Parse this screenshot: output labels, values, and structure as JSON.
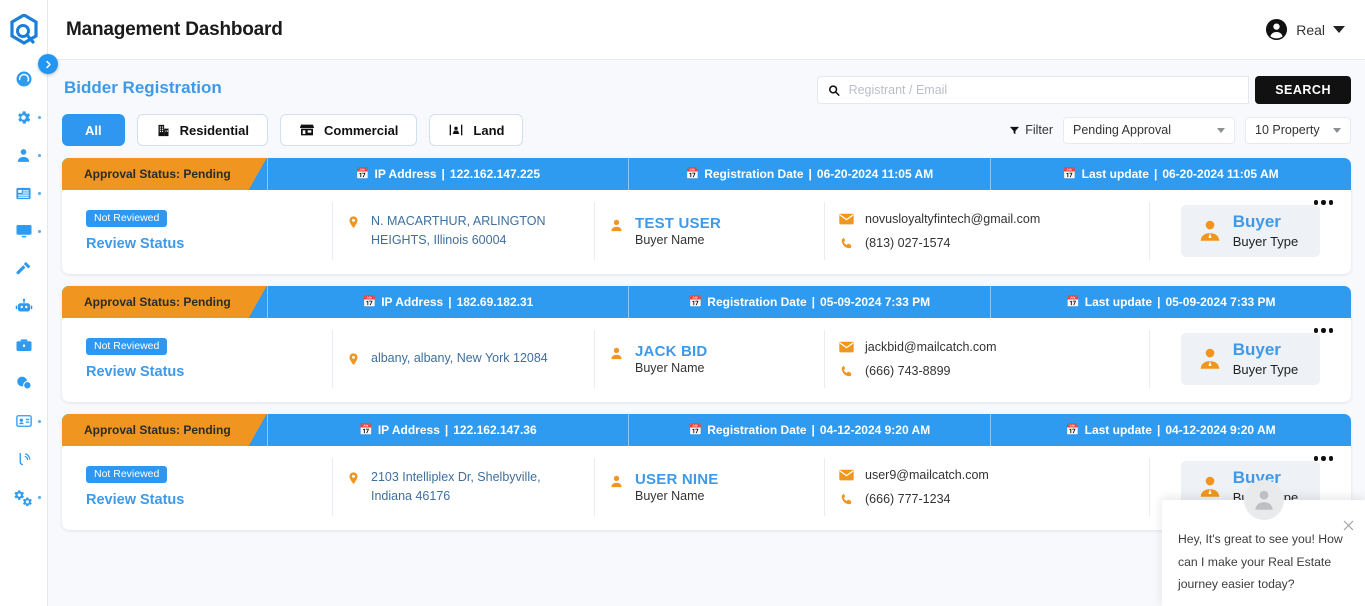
{
  "sidebar": {
    "logo_icon": "app-logo-icon",
    "toggle_icon": "chevron-right-icon",
    "items": [
      {
        "icon": "dashboard-speedometer-icon",
        "name": "dashboard",
        "dot": false
      },
      {
        "icon": "gear-icon",
        "name": "settings",
        "dot": true
      },
      {
        "icon": "person-icon",
        "name": "users",
        "dot": true
      },
      {
        "icon": "list-icon",
        "name": "listings",
        "dot": true
      },
      {
        "icon": "monitor-icon",
        "name": "monitor",
        "dot": true
      },
      {
        "icon": "hammer-gavel-icon",
        "name": "auctions",
        "dot": false
      },
      {
        "icon": "robot-icon",
        "name": "automation",
        "dot": false
      },
      {
        "icon": "briefcase-icon",
        "name": "portfolio",
        "dot": false
      },
      {
        "icon": "chat-bubbles-icon",
        "name": "messages",
        "dot": false
      },
      {
        "icon": "id-card-icon",
        "name": "contacts",
        "dot": true
      },
      {
        "icon": "broadcast-signal-icon",
        "name": "broadcast",
        "dot": false
      },
      {
        "icon": "gears-icon",
        "name": "configuration",
        "dot": true
      }
    ]
  },
  "topbar": {
    "title": "Management Dashboard",
    "user_icon": "account-circle-icon",
    "user_name": "Real",
    "caret_icon": "chevron-down-icon"
  },
  "page": {
    "title": "Bidder Registration"
  },
  "search": {
    "icon": "search-icon",
    "placeholder": "Registrant / Email",
    "value": "",
    "button_label": "SEARCH"
  },
  "tabs": [
    {
      "label": "All",
      "icon": "",
      "active": true
    },
    {
      "label": "Residential",
      "icon": "building-icon",
      "active": false
    },
    {
      "label": "Commercial",
      "icon": "store-icon",
      "active": false
    },
    {
      "label": "Land",
      "icon": "land-plot-icon",
      "active": false
    }
  ],
  "filters": {
    "filter_icon": "funnel-filter-icon",
    "filter_label": "Filter",
    "status_select": "Pending Approval",
    "count_select": "10 Property"
  },
  "labels": {
    "ip_address": "IP Address",
    "registration_date": "Registration Date",
    "last_update": "Last update",
    "review_status": "Review Status",
    "buyer_name": "Buyer Name",
    "buyer_type": "Buyer Type",
    "separator": "|"
  },
  "colors": {
    "orange": "#ef9520",
    "blue": "#2e9bf0",
    "link_blue": "#3e9ae8",
    "dark": "#111111",
    "page_bg": "#f7f9fc"
  },
  "cards": [
    {
      "approval_status": "Approval Status: Pending",
      "ip_address": "122.162.147.225",
      "registration_date": "06-20-2024 11:05 AM",
      "last_update": "06-20-2024 11:05 AM",
      "badge": "Not Reviewed",
      "review_status": "Review Status",
      "address": "N. MACARTHUR, ARLINGTON HEIGHTS, Illinois 60004",
      "buyer_name": "TEST USER",
      "buyer_name_label": "Buyer Name",
      "email": "novusloyaltyfintech@gmail.com",
      "phone": "(813) 027-1574",
      "buyer_type_title": "Buyer",
      "buyer_type_label": "Buyer Type"
    },
    {
      "approval_status": "Approval Status: Pending",
      "ip_address": "182.69.182.31",
      "registration_date": "05-09-2024 7:33 PM",
      "last_update": "05-09-2024 7:33 PM",
      "badge": "Not Reviewed",
      "review_status": "Review Status",
      "address": "albany, albany, New York 12084",
      "buyer_name": "JACK BID",
      "buyer_name_label": "Buyer Name",
      "email": "jackbid@mailcatch.com",
      "phone": "(666) 743-8899",
      "buyer_type_title": "Buyer",
      "buyer_type_label": "Buyer Type"
    },
    {
      "approval_status": "Approval Status: Pending",
      "ip_address": "122.162.147.36",
      "registration_date": "04-12-2024 9:20 AM",
      "last_update": "04-12-2024 9:20 AM",
      "badge": "Not Reviewed",
      "review_status": "Review Status",
      "address": "2103 Intelliplex Dr, Shelbyville, Indiana 46176",
      "buyer_name": "USER NINE",
      "buyer_name_label": "Buyer Name",
      "email": "user9@mailcatch.com",
      "phone": "(666) 777-1234",
      "buyer_type_title": "Buyer",
      "buyer_type_label": "Buyer Type"
    }
  ],
  "chat": {
    "avatar_icon": "user-avatar-icon",
    "close_icon": "close-icon",
    "message": "Hey, It's great to see you! How can I make your Real Estate journey easier today?"
  }
}
